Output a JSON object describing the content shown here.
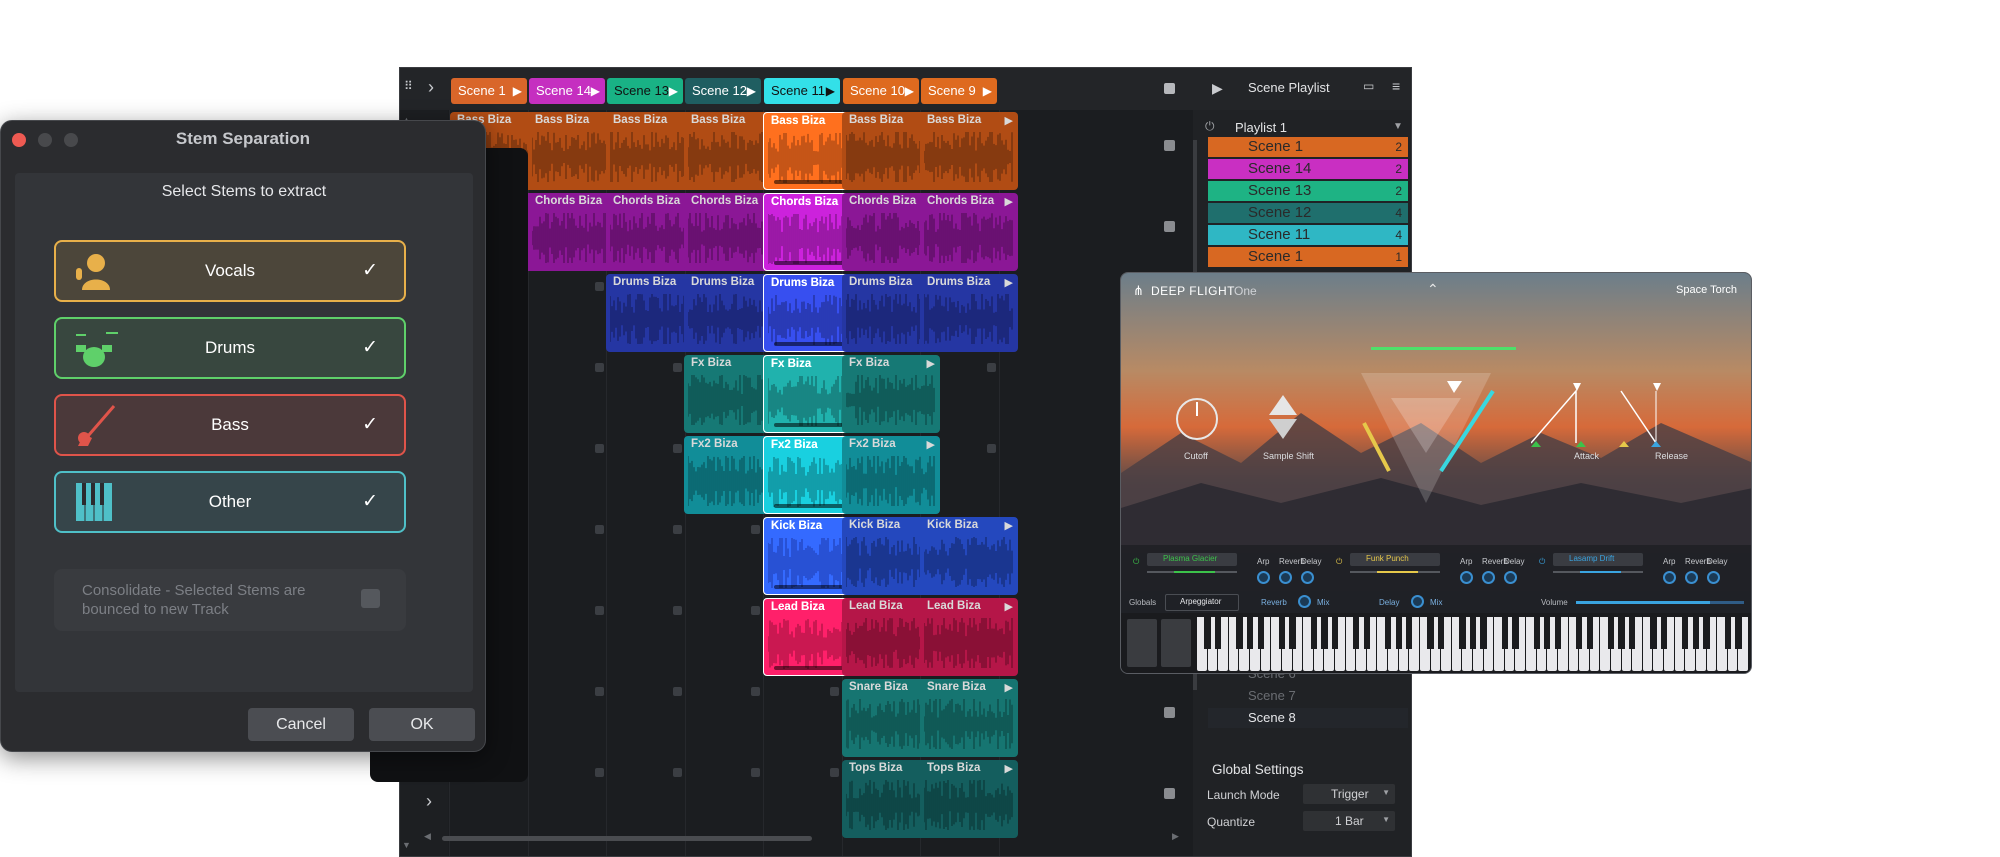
{
  "launcher": {
    "scenes": [
      {
        "label": "Scene 1",
        "color": "#d9662a"
      },
      {
        "label": "Scene 14",
        "color": "#c52fc0"
      },
      {
        "label": "Scene 13",
        "color": "#19b285"
      },
      {
        "label": "Scene 12",
        "color": "#1f5e61"
      },
      {
        "label": "Scene 11",
        "color": "#33e0e8"
      },
      {
        "label": "Scene 10",
        "color": "#de6a1f"
      },
      {
        "label": "Scene 9",
        "color": "#de6a1f"
      }
    ],
    "rows": [
      {
        "name": "Bass Biza",
        "color": "#d05a18"
      },
      {
        "name": "Chords Biza",
        "color": "#a31bb0"
      },
      {
        "name": "Drums Biza",
        "color": "#2c3fc0"
      },
      {
        "name": "Fx Biza",
        "color": "#1a8e8a"
      },
      {
        "name": "Fx2 Biza",
        "color": "#14a6b3"
      },
      {
        "name": "Kick Biza",
        "color": "#2a55e0"
      },
      {
        "name": "Lead Biza",
        "color": "#d51a55"
      },
      {
        "name": "Snare Biza",
        "color": "#1a8a85"
      },
      {
        "name": "Tops Biza",
        "color": "#176e6e"
      }
    ],
    "playlist": {
      "title": "Scene Playlist",
      "name": "Playlist 1",
      "entries": [
        {
          "label": "Scene 1",
          "count": "2",
          "color": "#d86822"
        },
        {
          "label": "Scene 14",
          "count": "2",
          "color": "#c92fc2"
        },
        {
          "label": "Scene 13",
          "count": "2",
          "color": "#1eb384"
        },
        {
          "label": "Scene 12",
          "count": "4",
          "color": "#1f6f6d"
        },
        {
          "label": "Scene 11",
          "count": "4",
          "color": "#2fb7c4"
        },
        {
          "label": "Scene 1",
          "count": "1",
          "color": "#d86822"
        }
      ],
      "extra": [
        "Scene 6",
        "Scene 7",
        "Scene 8"
      ]
    },
    "global_settings": {
      "title": "Global Settings",
      "launch_mode_label": "Launch Mode",
      "launch_mode_value": "Trigger",
      "quantize_label": "Quantize",
      "quantize_value": "1 Bar"
    }
  },
  "dialog": {
    "title": "Stem Separation",
    "subtitle": "Select Stems to extract",
    "stems": [
      {
        "label": "Vocals",
        "icon": "singer-icon",
        "color": "#e8b04a",
        "checked": true
      },
      {
        "label": "Drums",
        "icon": "drum-kit-icon",
        "color": "#5fd06a",
        "checked": true
      },
      {
        "label": "Bass",
        "icon": "bass-guitar-icon",
        "color": "#e0544a",
        "checked": true
      },
      {
        "label": "Other",
        "icon": "piano-keys-icon",
        "color": "#4fc0c8",
        "checked": true
      }
    ],
    "check_glyph": "✓",
    "consolidate": "Consolidate - Selected Stems are bounced to new Track",
    "cancel": "Cancel",
    "ok": "OK"
  },
  "synth": {
    "title": "DEEP FLIGHT",
    "title_suffix": "One",
    "preset": "Space Torch",
    "knobs": {
      "cutoff": "Cutoff",
      "sample_shift": "Sample Shift",
      "attack": "Attack",
      "release": "Release"
    },
    "layers": [
      {
        "name": "Plasma Glacier",
        "color": "#3cc24a"
      },
      {
        "name": "Funk Punch",
        "color": "#e6c84a"
      },
      {
        "name": "Lasamp Drift",
        "color": "#3aa4e0"
      }
    ],
    "fx_labels": {
      "arp": "Arp",
      "reverb": "Reverb",
      "delay": "Delay"
    },
    "globals": {
      "label": "Globals",
      "arpeggiator": "Arpeggiator",
      "reverb": "Reverb",
      "mix": "Mix",
      "delay": "Delay",
      "volume": "Volume"
    }
  }
}
